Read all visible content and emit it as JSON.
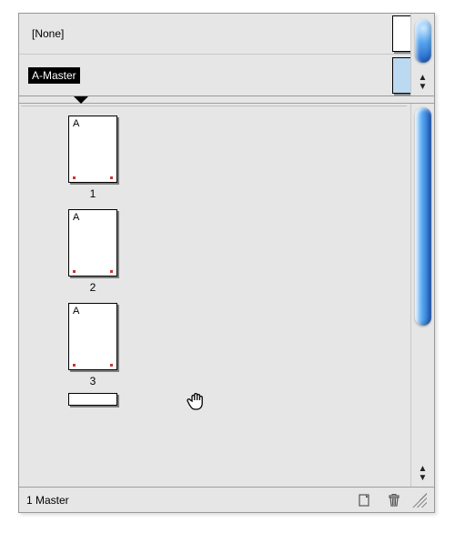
{
  "masters": {
    "none_label": "[None]",
    "a_master_label": "A-Master",
    "selected_index": 1
  },
  "pages": [
    {
      "number": "1",
      "prefix": "A"
    },
    {
      "number": "2",
      "prefix": "A"
    },
    {
      "number": "3",
      "prefix": "A"
    }
  ],
  "footer": {
    "status": "1 Master"
  },
  "icons": {
    "new_page": "new-page-icon",
    "trash": "trash-icon"
  }
}
